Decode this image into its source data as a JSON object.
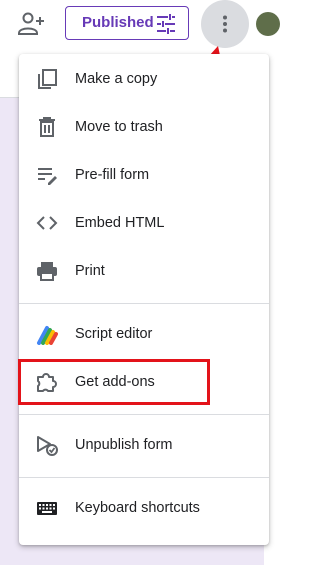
{
  "toolbar": {
    "published_label": "Published",
    "icons": {
      "add_collaborator": "person-add-icon",
      "publish_settings": "tune-icon",
      "more_options": "more-vert-icon"
    }
  },
  "menu": {
    "items": [
      {
        "label": "Make a copy",
        "icon": "copy-icon"
      },
      {
        "label": "Move to trash",
        "icon": "trash-icon"
      },
      {
        "label": "Pre-fill form",
        "icon": "prefill-icon"
      },
      {
        "label": "Embed HTML",
        "icon": "code-icon"
      },
      {
        "label": "Print",
        "icon": "print-icon"
      },
      {
        "label": "Script editor",
        "icon": "apps-script-icon"
      },
      {
        "label": "Get add-ons",
        "icon": "puzzle-icon"
      },
      {
        "label": "Unpublish form",
        "icon": "unpublish-icon"
      },
      {
        "label": "Keyboard shortcuts",
        "icon": "keyboard-icon"
      }
    ]
  },
  "annotations": {
    "arrow_color": "#e3131a",
    "highlight_color": "#e3131a",
    "highlighted_item": "Get add-ons"
  },
  "colors": {
    "accent": "#673ab7",
    "background": "#ede7f6"
  }
}
